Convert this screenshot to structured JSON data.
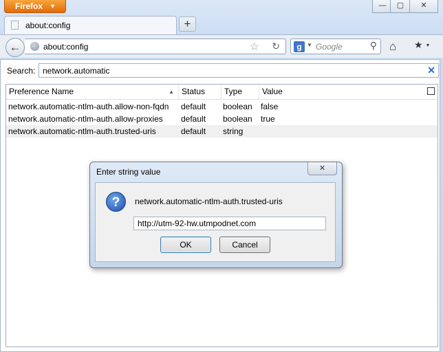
{
  "app": {
    "menu_button": "Firefox",
    "menu_arrow": "▼"
  },
  "window_controls": {
    "minimize": "—",
    "maximize": "▢",
    "close": "✕"
  },
  "tabs": [
    {
      "label": "about:config"
    }
  ],
  "new_tab": "+",
  "navbar": {
    "back": "←",
    "url": "about:config",
    "star": "☆",
    "reload": "↻",
    "search_engine": "g",
    "search_dropdown": "▼",
    "search_placeholder": "Google",
    "search_go": "⚲",
    "home": "⌂",
    "bookmarks": "★"
  },
  "filter": {
    "label": "Search:",
    "value": "network.automatic",
    "clear": "✕"
  },
  "table": {
    "columns": [
      "Preference Name",
      "Status",
      "Type",
      "Value"
    ],
    "sort_arrow": "▲",
    "rows": [
      {
        "name": "network.automatic-ntlm-auth.allow-non-fqdn",
        "status": "default",
        "type": "boolean",
        "value": "false"
      },
      {
        "name": "network.automatic-ntlm-auth.allow-proxies",
        "status": "default",
        "type": "boolean",
        "value": "true"
      },
      {
        "name": "network.automatic-ntlm-auth.trusted-uris",
        "status": "default",
        "type": "string",
        "value": ""
      }
    ]
  },
  "dialog": {
    "title": "Enter string value",
    "close": "✕",
    "icon": "?",
    "prompt": "network.automatic-ntlm-auth.trusted-uris",
    "value": "http://utm-92-hw.utmpodnet.com",
    "ok": "OK",
    "cancel": "Cancel"
  }
}
